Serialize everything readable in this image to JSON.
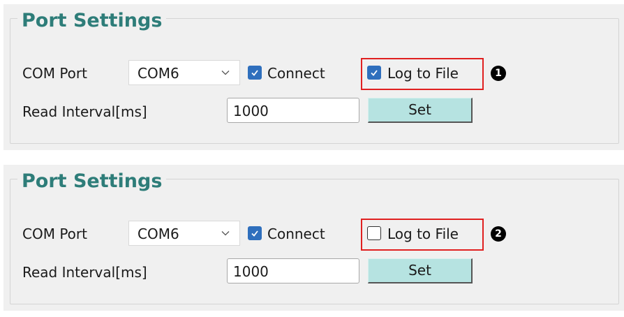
{
  "panels": [
    {
      "title": "Port Settings",
      "com_port_label": "COM Port",
      "com_port_value": "COM6",
      "connect_label": "Connect",
      "connect_checked": true,
      "log_label": "Log to File",
      "log_checked": true,
      "badge": "1",
      "read_interval_label": "Read Interval[ms]",
      "read_interval_value": "1000",
      "set_label": "Set"
    },
    {
      "title": "Port Settings",
      "com_port_label": "COM Port",
      "com_port_value": "COM6",
      "connect_label": "Connect",
      "connect_checked": true,
      "log_label": "Log to File",
      "log_checked": false,
      "badge": "2",
      "read_interval_label": "Read Interval[ms]",
      "read_interval_value": "1000",
      "set_label": "Set"
    }
  ],
  "colors": {
    "title": "#2e7d79",
    "checkbox_checked": "#2f6fbd",
    "highlight": "#e02020",
    "set_button": "#b6e3e1"
  },
  "icons": {
    "dropdown": "chevron-down-icon",
    "check": "checkmark-icon"
  }
}
